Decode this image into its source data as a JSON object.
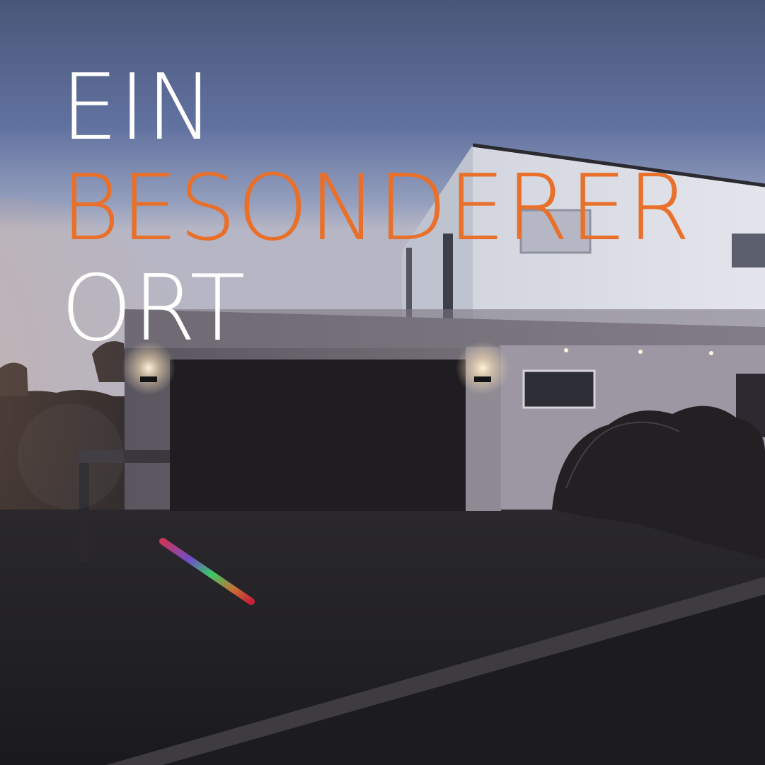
{
  "headline": {
    "line1": "EIN",
    "line2": "BESONDERER",
    "line3": "ORT"
  },
  "colors": {
    "accent_orange": "#e8702a",
    "text_white": "#ffffff",
    "sky_top": "#4a5a7e",
    "sky_horizon": "#a9b0c4"
  },
  "scene": {
    "subject": "modern-house-at-dusk-illustration"
  }
}
